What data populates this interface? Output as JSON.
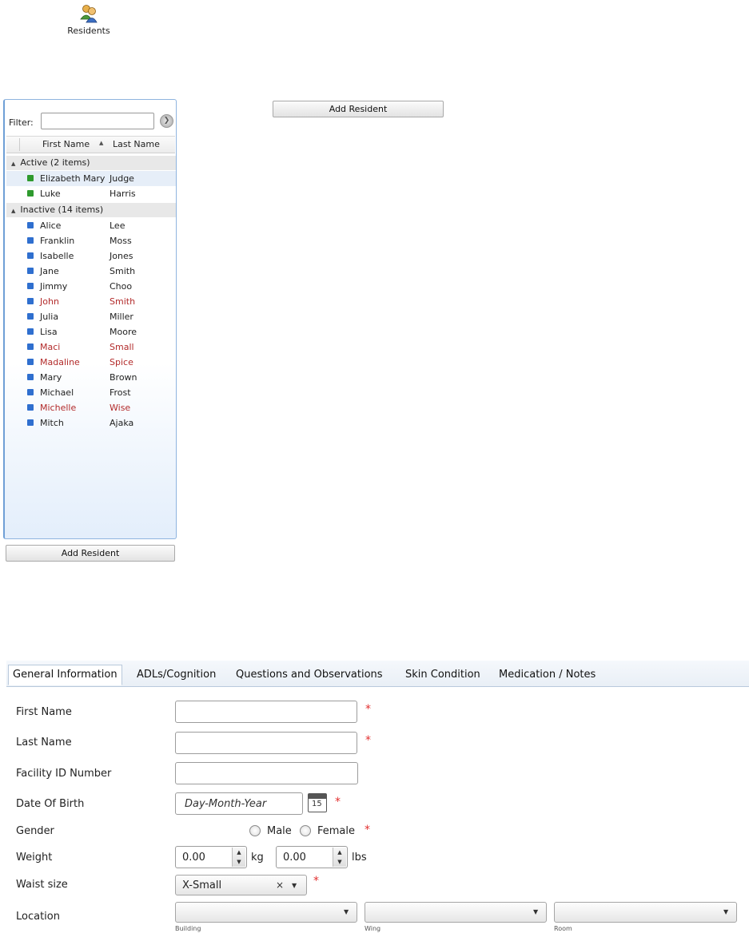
{
  "app": {
    "icon": "residents-icon",
    "label": "Residents"
  },
  "top_button": "Add Resident",
  "panel": {
    "filter_label": "Filter:",
    "filter_value": "",
    "col_first": "First Name",
    "col_last": "Last Name",
    "sort_icon": "▲",
    "groups": [
      {
        "label": "Active (2 items)",
        "status_color": "#2e9a2e"
      },
      {
        "label": "Inactive (14 items)",
        "status_color": "#2f6fcf"
      }
    ],
    "active": [
      {
        "first": "Elizabeth Mary",
        "last": "Judge",
        "red": false
      },
      {
        "first": "Luke",
        "last": "Harris",
        "red": false
      }
    ],
    "inactive": [
      {
        "first": "Alice",
        "last": "Lee",
        "red": false
      },
      {
        "first": "Franklin",
        "last": "Moss",
        "red": false
      },
      {
        "first": "Isabelle",
        "last": "Jones",
        "red": false
      },
      {
        "first": "Jane",
        "last": "Smith",
        "red": false
      },
      {
        "first": "Jimmy",
        "last": "Choo",
        "red": false
      },
      {
        "first": "John",
        "last": "Smith",
        "red": true
      },
      {
        "first": "Julia",
        "last": "Miller",
        "red": false
      },
      {
        "first": "Lisa",
        "last": "Moore",
        "red": false
      },
      {
        "first": "Maci",
        "last": "Small",
        "red": true
      },
      {
        "first": "Madaline",
        "last": "Spice",
        "red": true
      },
      {
        "first": "Mary",
        "last": "Brown",
        "red": false
      },
      {
        "first": "Michael",
        "last": "Frost",
        "red": false
      },
      {
        "first": "Michelle",
        "last": "Wise",
        "red": true
      },
      {
        "first": "Mitch",
        "last": "Ajaka",
        "red": false
      }
    ],
    "add_button": "Add Resident"
  },
  "tabs": [
    "General Information",
    "ADLs/Cognition",
    "Questions and Observations",
    "Skin Condition",
    "Medication / Notes"
  ],
  "form": {
    "first_name_label": "First Name",
    "last_name_label": "Last Name",
    "facility_label": "Facility ID Number",
    "dob_label": "Date Of Birth",
    "dob_placeholder": "Day-Month-Year",
    "calendar_day": "15",
    "gender_label": "Gender",
    "gender_male": "Male",
    "gender_female": "Female",
    "weight_label": "Weight",
    "weight_kg": "0.00",
    "unit_kg": "kg",
    "weight_lbs": "0.00",
    "unit_lbs": "lbs",
    "waist_label": "Waist size",
    "waist_value": "X-Small",
    "location_label": "Location",
    "building_label": "Building",
    "wing_label": "Wing",
    "room_label": "Room",
    "required_mark": "*"
  }
}
